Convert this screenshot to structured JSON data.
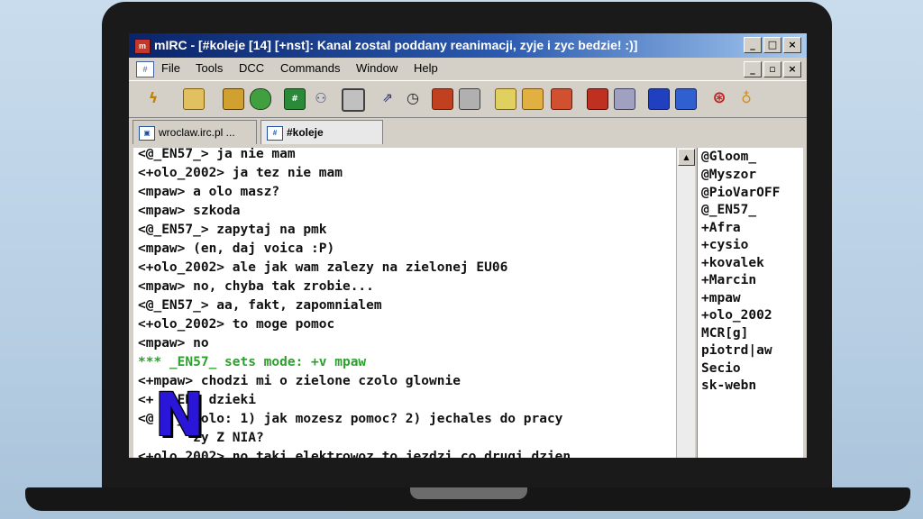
{
  "window": {
    "title": "mIRC - [#koleje [14] [+nst]: Kanal zostal poddany reanimacji, zyje i zyc bedzie! :)]",
    "buttons": [
      "_",
      "□",
      "×"
    ]
  },
  "menubar": {
    "items": [
      "File",
      "Tools",
      "DCC",
      "Commands",
      "Window",
      "Help"
    ],
    "mdi_buttons": [
      "_",
      "▫",
      "×"
    ]
  },
  "tabs": [
    {
      "label": "wroclaw.irc.pl ...",
      "active": false
    },
    {
      "label": "#koleje",
      "active": true
    }
  ],
  "chat": {
    "lines": [
      "<@_EN57_> ja nie mam",
      "<+olo_2002> ja tez nie mam",
      "<mpaw> a olo masz?",
      "<mpaw> szkoda",
      "<@_EN57_> zapytaj na pmk",
      "<mpaw> (en, daj voica :P)",
      "<+olo_2002> ale jak wam zalezy na zielonej EU06",
      "<mpaw> no, chyba tak zrobie...",
      "<@_EN57_> aa, fakt, zapomnialem",
      "<+olo_2002> to moge pomoc",
      "<mpaw> no",
      "*** _EN57_ sets mode: +v mpaw",
      "<+mpaw> chodzi mi o zielone czolo glownie",
      "<+   EN: dzieki",
      "<@   _> olo: 1) jak mozesz pomoc? 2) jechales do pracy",
      "       zy Z NIA?",
      "<+olo_2002> no taki elektrowoz to jezdzi co drugi dzien"
    ]
  },
  "nicklist": {
    "nicks": [
      "@Gloom_",
      "@Myszor",
      "@PioVarOFF",
      "@_EN57_",
      "+Afra",
      "+cysio",
      "+kovalek",
      "+Marcin",
      "+mpaw",
      "+olo_2002",
      "MCR[g]",
      "piotrd|aw",
      "Secio",
      "sk-webn"
    ]
  },
  "watermark": {
    "text": "N"
  }
}
